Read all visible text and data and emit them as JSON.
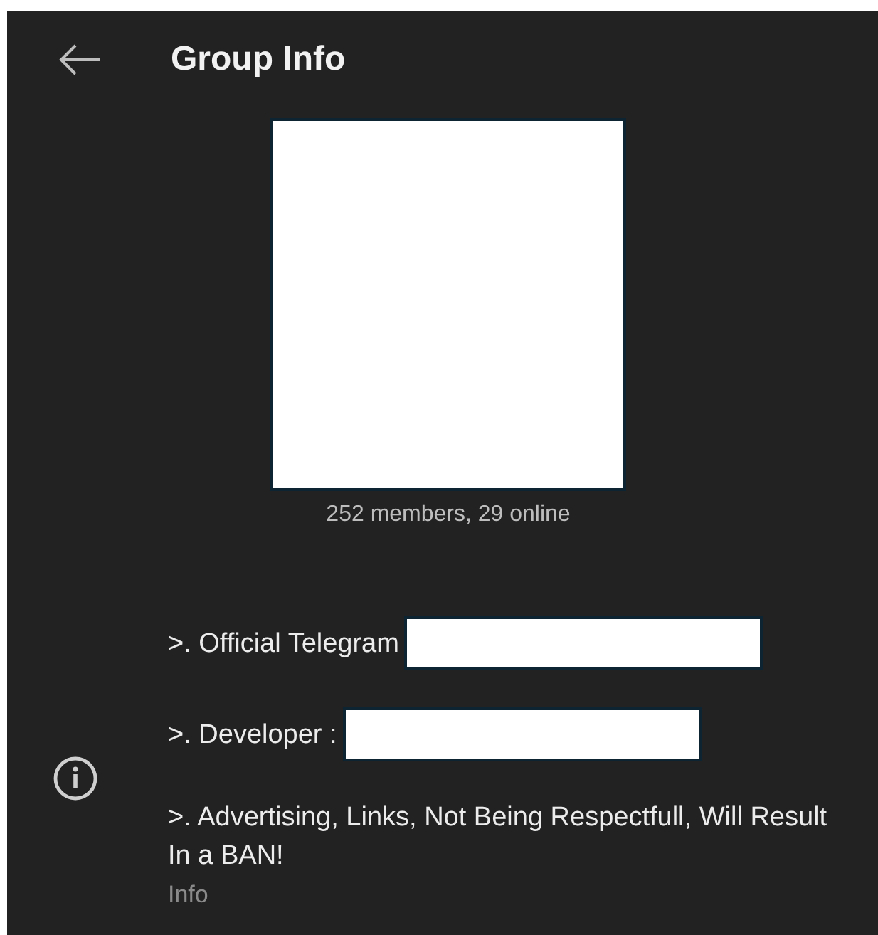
{
  "header": {
    "title": "Group Info"
  },
  "group": {
    "subtitle": "252 members, 29 online"
  },
  "info": {
    "lines": [
      {
        "text": ">. Official Telegram",
        "redacted": true
      },
      {
        "text": ">. Developer :",
        "redacted": true
      },
      {
        "text": ">. Advertising, Links, Not Being Respectfull, Will Result In a BAN!",
        "redacted": false
      }
    ],
    "caption": "Info"
  }
}
